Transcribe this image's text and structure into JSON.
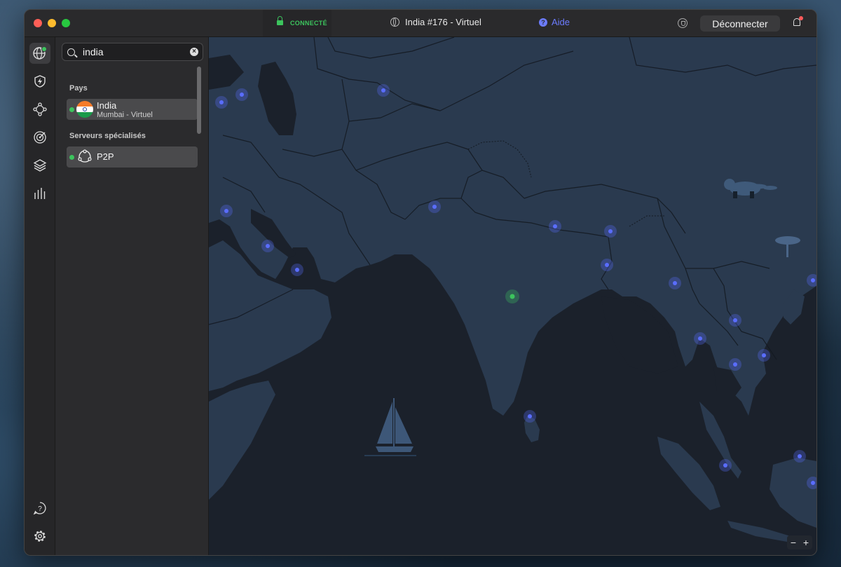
{
  "window": {
    "status": "CONNECTÉ",
    "server_name": "India #176 - Virtuel",
    "help_label": "Aide",
    "disconnect_label": "Déconnecter"
  },
  "sidebar": {
    "search": {
      "value": "india",
      "placeholder": ""
    },
    "sections": {
      "countries": "Pays",
      "specialized": "Serveurs spécialisés"
    },
    "country_item": {
      "name": "India",
      "sub": "Mumbai - Virtuel",
      "flag": "india-flag"
    },
    "specialized_item": {
      "name": "P2P",
      "icon": "p2p-icon"
    }
  },
  "iconbar": {
    "top": [
      "globe-icon",
      "lightning-shield-icon",
      "meshnet-icon",
      "target-icon",
      "layers-icon",
      "stats-icon"
    ],
    "bottom": [
      "help-icon",
      "gear-icon"
    ]
  },
  "map": {
    "zoom_out": "−",
    "zoom_in": "+",
    "connected_color": "#3cc45d",
    "server_color": "#5a6dff",
    "land_color": "#2a3a4f",
    "sea_color": "#1b212b"
  }
}
